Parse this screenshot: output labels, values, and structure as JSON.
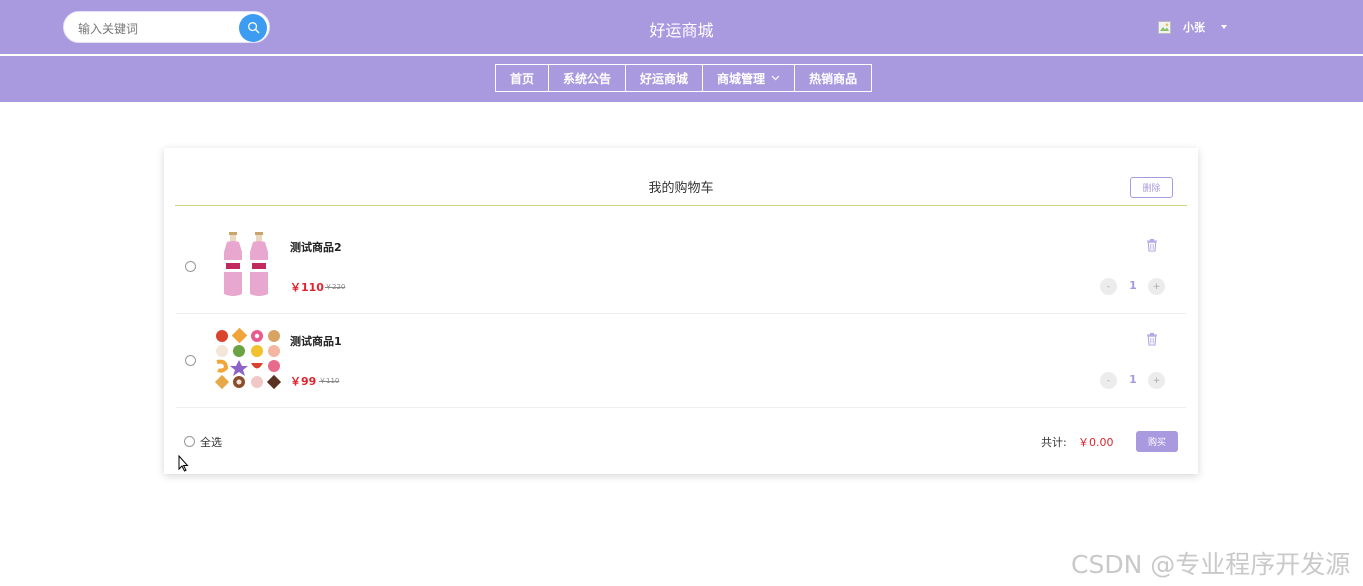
{
  "header": {
    "search_placeholder": "输入关键词",
    "site_title": "好运商城",
    "username": "小张"
  },
  "nav": {
    "items": [
      {
        "label": "首页"
      },
      {
        "label": "系统公告"
      },
      {
        "label": "好运商城"
      },
      {
        "label": "商城管理"
      },
      {
        "label": "热销商品"
      }
    ]
  },
  "cart": {
    "title": "我的购物车",
    "delete_label": "删除",
    "items": [
      {
        "name": "测试商品2",
        "price": "￥110",
        "original_price": "￥220",
        "quantity": "1",
        "minus": "-",
        "plus": "+"
      },
      {
        "name": "测试商品1",
        "price": "￥99",
        "original_price": "￥110",
        "quantity": "1",
        "minus": "-",
        "plus": "+"
      }
    ],
    "select_all_label": "全选",
    "total_label": "共计:",
    "total_value": "￥0.00",
    "buy_label": "购买"
  },
  "watermark": "CSDN @专业程序开发源",
  "colors": {
    "header_bg": "#a99ae0",
    "price_red": "#e0242e",
    "search_button": "#3c9cf1",
    "divider_accent": "#cfd57a"
  }
}
